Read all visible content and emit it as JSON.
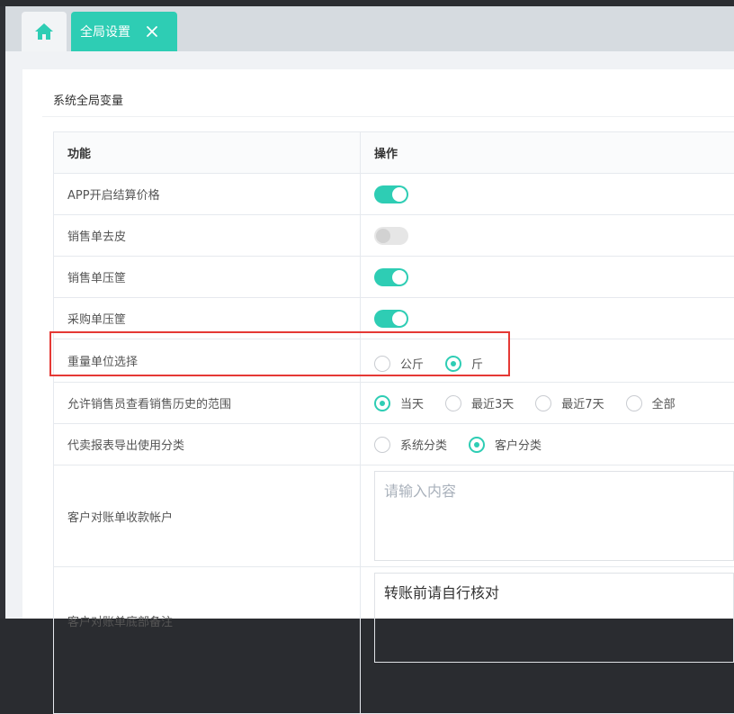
{
  "tabs": {
    "home_icon": "home-icon",
    "active_label": "全局设置"
  },
  "section": {
    "title": "系统全局变量"
  },
  "table": {
    "headers": [
      "功能",
      "操作"
    ],
    "rows": [
      {
        "label": "APP开启结算价格",
        "type": "switch",
        "on": true
      },
      {
        "label": "销售单去皮",
        "type": "switch",
        "on": false
      },
      {
        "label": "销售单压筐",
        "type": "switch",
        "on": true
      },
      {
        "label": "采购单压筐",
        "type": "switch",
        "on": true
      },
      {
        "label": "重量单位选择",
        "type": "radio",
        "options": [
          "公斤",
          "斤"
        ],
        "selected": "斤"
      },
      {
        "label": "允许销售员查看销售历史的范围",
        "type": "radio",
        "options": [
          "当天",
          "最近3天",
          "最近7天",
          "全部"
        ],
        "selected": "当天"
      },
      {
        "label": "代卖报表导出使用分类",
        "type": "radio",
        "options": [
          "系统分类",
          "客户分类"
        ],
        "selected": "客户分类"
      },
      {
        "label": "客户对账单收款帐户",
        "type": "textarea",
        "placeholder": "请输入内容",
        "value": ""
      },
      {
        "label": "客户对账单底部备注",
        "type": "textarea",
        "placeholder": "",
        "value": "转账前请自行核对"
      }
    ]
  },
  "colors": {
    "accent": "#2ecdb4",
    "highlight": "#e53935"
  }
}
